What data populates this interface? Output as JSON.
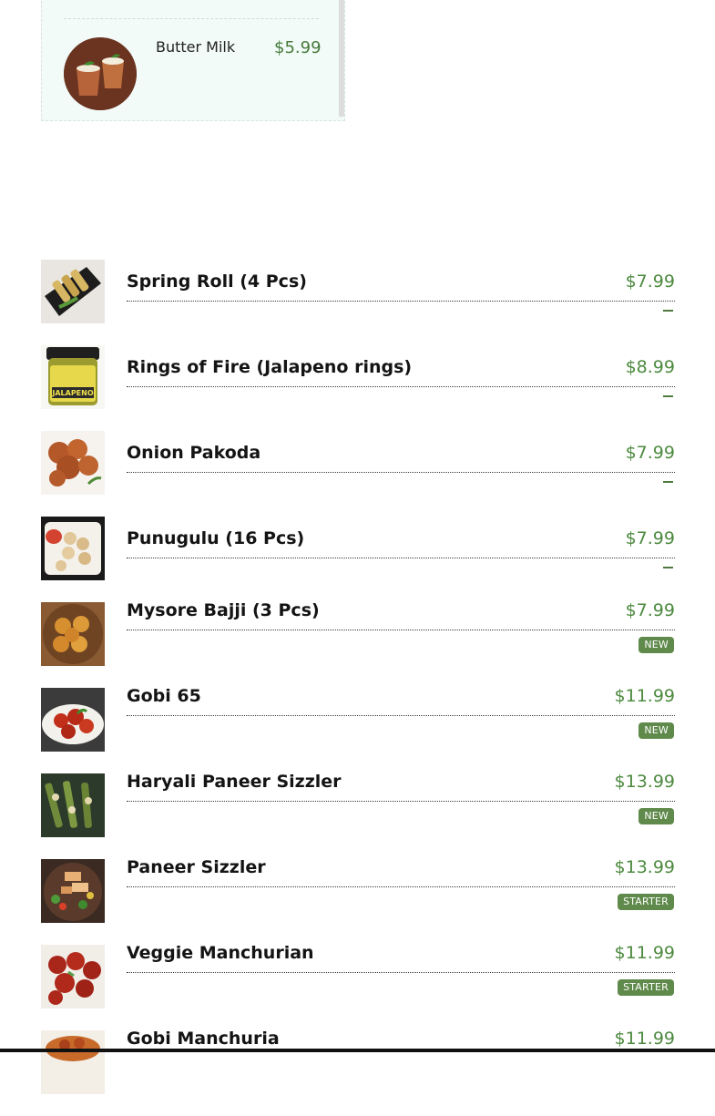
{
  "top_card": {
    "item_name": "Butter Milk",
    "item_price": "$5.99",
    "image_icon": "buttermilk-cups-image"
  },
  "menu": {
    "items": [
      {
        "name": "Spring Roll (4 Pcs)",
        "price": "$7.99",
        "marker": "dash",
        "image": "spring-roll-image"
      },
      {
        "name": "Rings of Fire (Jalapeno rings)",
        "price": "$8.99",
        "marker": "dash",
        "image": "jalapeno-jar-image"
      },
      {
        "name": "Onion Pakoda",
        "price": "$7.99",
        "marker": "dash",
        "image": "onion-pakoda-image"
      },
      {
        "name": "Punugulu (16 Pcs)",
        "price": "$7.99",
        "marker": "dash",
        "image": "punugulu-image"
      },
      {
        "name": "Mysore Bajji (3 Pcs)",
        "price": "$7.99",
        "badge": "NEW",
        "image": "mysore-bajji-image"
      },
      {
        "name": "Gobi 65",
        "price": "$11.99",
        "badge": "NEW",
        "image": "gobi-65-image"
      },
      {
        "name": "Haryali Paneer Sizzler",
        "price": "$13.99",
        "badge": "NEW",
        "image": "haryali-paneer-image"
      },
      {
        "name": "Paneer Sizzler",
        "price": "$13.99",
        "badge": "STARTER",
        "image": "paneer-sizzler-image"
      },
      {
        "name": "Veggie Manchurian",
        "price": "$11.99",
        "badge": "STARTER",
        "image": "veggie-manchurian-image"
      },
      {
        "name": "Gobi Manchuria",
        "price": "$11.99",
        "image": "gobi-manchuria-image"
      }
    ]
  },
  "colors": {
    "price_green": "#4d8a3f",
    "badge_green": "#5f8a4b",
    "card_bg": "#f2fbf8"
  }
}
